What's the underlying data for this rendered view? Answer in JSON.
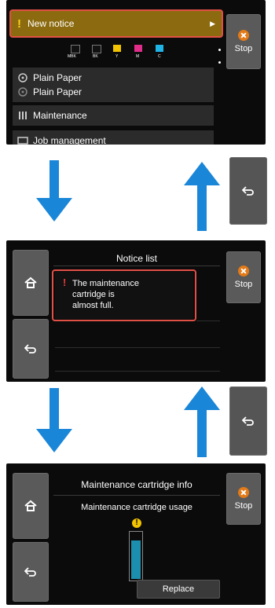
{
  "screen1": {
    "notice_label": "New notice",
    "ink_labels": [
      "MBK",
      "BK",
      "Y",
      "M",
      "C"
    ],
    "ink_colors": [
      "#111111",
      "#111111",
      "#f2c300",
      "#e02d8a",
      "#1fb3e6"
    ],
    "paper_items": [
      "Plain Paper",
      "Plain Paper"
    ],
    "maintenance_label": "Maintenance",
    "partial_item_label": "Job management",
    "stop_label": "Stop"
  },
  "screen2": {
    "title": "Notice list",
    "notice_text_lines": [
      "The maintenance",
      "cartridge is",
      "almost full."
    ],
    "stop_label": "Stop"
  },
  "screen3": {
    "title": "Maintenance cartridge info",
    "subtitle": "Maintenance cartridge usage",
    "warning_glyph": "!",
    "usage_level": 0.85,
    "replace_label": "Replace",
    "stop_label": "Stop"
  },
  "colors": {
    "arrow": "#1a86d8",
    "highlight": "#e05045",
    "notice_bar": "#8c6b10",
    "stop": "#e37a18",
    "cartridge_fill": "#1c8fae"
  }
}
